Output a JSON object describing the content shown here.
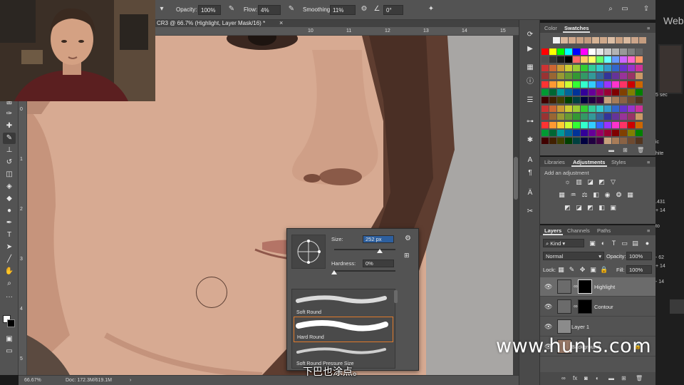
{
  "options_bar": {
    "opacity_label": "Opacity:",
    "opacity_value": "100%",
    "flow_label": "Flow:",
    "flow_value": "4%",
    "smoothing_label": "Smoothing:",
    "smoothing_value": "11%",
    "angle_value": "0°"
  },
  "document": {
    "title": "CR3 @ 66.7% (Highlight, Layer Mask/16) *",
    "ruler_ticks": [
      "10",
      "11",
      "12",
      "13",
      "14",
      "15",
      "16"
    ],
    "vruler_ticks": [
      "0",
      "1",
      "2",
      "3",
      "4",
      "5"
    ],
    "zoom": "66.67%",
    "doc_size": "Doc: 172.3M/619.1M"
  },
  "swatches_panel": {
    "tabs": [
      "Color",
      "Swatches"
    ],
    "active_tab": "Swatches",
    "top_row": [
      "#f1f1f1",
      "#d8b79d",
      "#d2aa8e",
      "#c9a184",
      "#c19a7e",
      "#d6b394",
      "#cfa98b",
      "#dcbfa6",
      "#c8a082",
      "#d9b99e",
      "#cca58a",
      "#c49d80"
    ],
    "rows": [
      [
        "#ff0000",
        "#ffff00",
        "#00ff00",
        "#00ffff",
        "#0000ff",
        "#ff00ff",
        "#ffffff",
        "#e6e6e6",
        "#cccccc",
        "#b3b3b3",
        "#999999",
        "#808080",
        "#666666"
      ],
      [
        "#4d4d4d",
        "#333333",
        "#1a1a1a",
        "#000000",
        "#ff6666",
        "#ffcc66",
        "#ffff66",
        "#66ff66",
        "#66ffff",
        "#6699ff",
        "#cc66ff",
        "#ff66cc",
        "#ff9966"
      ],
      [
        "#cc3333",
        "#cc6633",
        "#cc9933",
        "#cccc33",
        "#99cc33",
        "#33cc33",
        "#33cc99",
        "#33cccc",
        "#3399cc",
        "#3366cc",
        "#6633cc",
        "#9933cc",
        "#cc3399"
      ],
      [
        "#993333",
        "#996633",
        "#999933",
        "#669933",
        "#339933",
        "#339966",
        "#339999",
        "#336699",
        "#333399",
        "#663399",
        "#993399",
        "#993366",
        "#cc9966"
      ],
      [
        "#ff3333",
        "#ff9933",
        "#ffcc33",
        "#ccff33",
        "#33ff33",
        "#33ffcc",
        "#33ccff",
        "#3366ff",
        "#9933ff",
        "#ff33cc",
        "#ff3366",
        "#cc0000",
        "#cc6600"
      ],
      [
        "#009933",
        "#006633",
        "#009999",
        "#006699",
        "#003399",
        "#330099",
        "#660099",
        "#990066",
        "#990033",
        "#800000",
        "#804000",
        "#808000",
        "#008000"
      ],
      [
        "#400000",
        "#402000",
        "#404000",
        "#004000",
        "#004040",
        "#000040",
        "#200040",
        "#400040",
        "#c8a07c",
        "#a87c58",
        "#8a6244",
        "#6e4a30",
        "#52341e"
      ]
    ]
  },
  "adjustments_panel": {
    "tabs": [
      "Libraries",
      "Adjustments",
      "Styles"
    ],
    "active_tab": "Adjustments",
    "hint": "Add an adjustment",
    "icons_row1": [
      "brightness-contrast-icon",
      "levels-icon",
      "curves-icon",
      "exposure-icon",
      "gradient-triangle-icon"
    ],
    "icons_row2": [
      "vibrance-icon",
      "hue-saturation-icon",
      "color-balance-icon",
      "black-white-icon",
      "photo-filter-icon",
      "channel-mixer-icon",
      "color-lookup-icon"
    ],
    "icons_row3": [
      "invert-icon",
      "posterize-icon",
      "threshold-icon",
      "selective-color-icon",
      "gradient-map-icon"
    ]
  },
  "layers_panel": {
    "tabs": [
      "Layers",
      "Channels",
      "Paths"
    ],
    "active_tab": "Layers",
    "filter_kind": "Kind",
    "blend_mode": "Normal",
    "opacity_label": "Opacity:",
    "opacity_value": "100%",
    "lock_label": "Lock:",
    "fill_label": "Fill:",
    "fill_value": "100%",
    "layers": [
      {
        "name": "Highlight",
        "selected": true
      },
      {
        "name": "Contour",
        "selected": false
      },
      {
        "name": "Layer 1",
        "selected": false
      },
      {
        "name": "Background",
        "selected": false
      }
    ]
  },
  "brush_popup": {
    "size_label": "Size:",
    "size_value": "252 px",
    "hardness_label": "Hardness:",
    "hardness_value": "0%",
    "presets": [
      "Soft Round",
      "Hard Round",
      "Soft Round Pressure Size"
    ],
    "selected_preset": "Hard Round"
  },
  "right_edge": {
    "label": "Web",
    "bits": [
      "5 sec",
      "ic",
      "hite",
      ".431",
      "+ 14",
      "to",
      "- 62",
      "+ 14",
      "- 14"
    ]
  },
  "overlays": {
    "watermark": "www.hunls.com",
    "subtitle": "下巴也涂点。"
  }
}
